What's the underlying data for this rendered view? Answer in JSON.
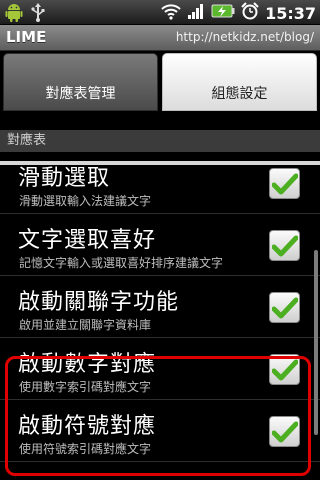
{
  "status_bar": {
    "time": "15:37",
    "icons": [
      "android-robot-icon",
      "usb-icon",
      "wifi-icon",
      "signal-icon",
      "battery-charging-icon",
      "alarm-clock-icon"
    ]
  },
  "title_bar": {
    "app_name": "LIME",
    "url": "http://netkidz.net/blog/"
  },
  "tabs": [
    {
      "label": "對應表管理",
      "selected": false
    },
    {
      "label": "組態設定",
      "selected": true
    }
  ],
  "category": {
    "label": "對應表"
  },
  "preferences": [
    {
      "title": "滑動選取",
      "summary": "滑動選取輸入法建議文字",
      "checked": true
    },
    {
      "title": "文字選取喜好",
      "summary": "記憶文字輸入或選取喜好排序建議文字",
      "checked": true
    },
    {
      "title": "啟動關聯字功能",
      "summary": "啟用並建立關聯字資料庫",
      "checked": true
    },
    {
      "title": "啟動數字對應",
      "summary": "使用數字索引碼對應文字",
      "checked": true
    },
    {
      "title": "啟動符號對應",
      "summary": "使用符號索引碼對應文字",
      "checked": true
    }
  ],
  "colors": {
    "highlight": "#e00000",
    "check_green": "#4caf21"
  }
}
